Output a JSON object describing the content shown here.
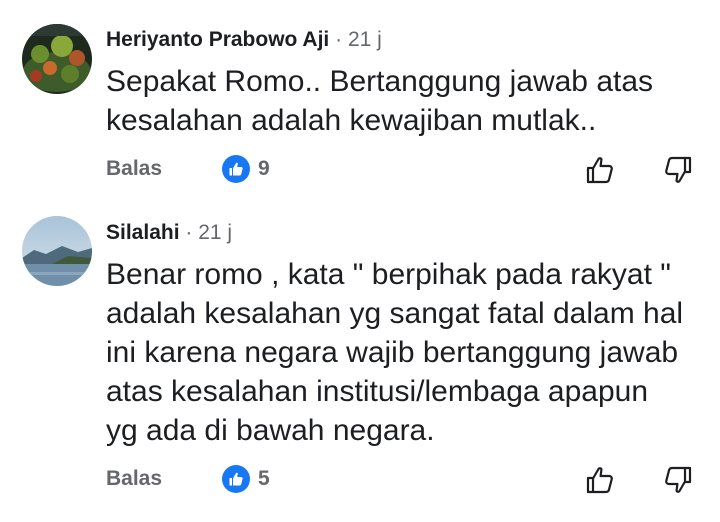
{
  "comments": [
    {
      "author": "Heriyanto Prabowo Aji",
      "separator": " · ",
      "time": "21 j",
      "text_lines": [
        "Sepakat Romo.. Bertanggung jawab atas",
        "kesalahan adalah kewajiban mutlak.."
      ],
      "reply_label": "Balas",
      "like_count": "9",
      "avatar_icon": "aquascape-photo-avatar"
    },
    {
      "author": "Silalahi",
      "separator": " · ",
      "time": "21 j",
      "text_lines": [
        "Benar romo , kata \" berpihak pada rakyat \"",
        "adalah kesalahan yg sangat fatal dalam hal",
        "ini karena negara wajib bertanggung jawab",
        "atas kesalahan institusi/lembaga apapun",
        "yg ada di bawah negara."
      ],
      "reply_label": "Balas",
      "like_count": "5",
      "avatar_icon": "lake-landscape-avatar"
    }
  ],
  "colors": {
    "like_badge": "#1877f2",
    "secondary_text": "#65676b",
    "primary_text": "#1c1e21"
  },
  "icons": [
    "thumbs-up-badge-icon",
    "thumbs-up-outline-icon",
    "thumbs-down-outline-icon"
  ]
}
